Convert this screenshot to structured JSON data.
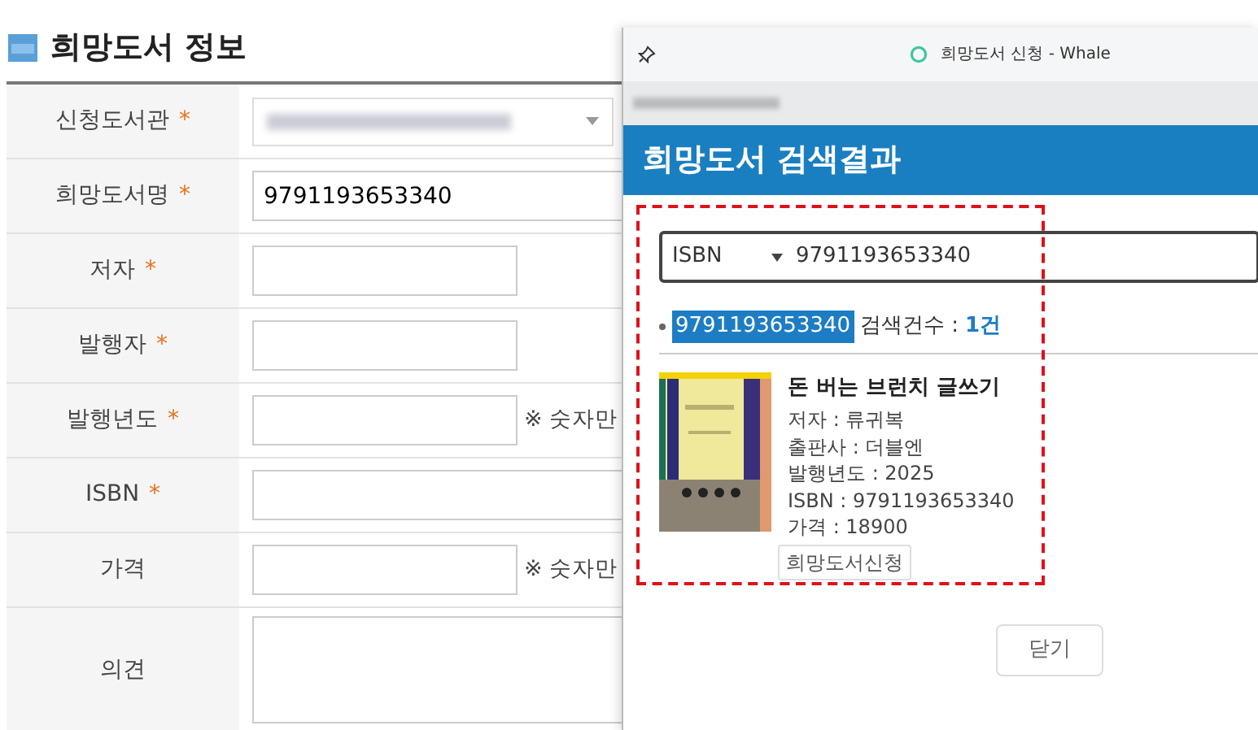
{
  "page": {
    "title": "희망도서 정보"
  },
  "form": {
    "required_mark": "*",
    "rows": [
      {
        "label": "신청도서관",
        "required": true,
        "kind": "select"
      },
      {
        "label": "희망도서명",
        "required": true,
        "kind": "text",
        "value": "9791193653340"
      },
      {
        "label": "저자",
        "required": true,
        "kind": "short"
      },
      {
        "label": "발행자",
        "required": true,
        "kind": "short"
      },
      {
        "label": "발행년도",
        "required": true,
        "kind": "short",
        "note": "※ 숫자만"
      },
      {
        "label": "ISBN",
        "required": true,
        "kind": "text"
      },
      {
        "label": "가격",
        "required": false,
        "kind": "short",
        "note": "※ 숫자만"
      },
      {
        "label": "의견",
        "required": false,
        "kind": "textarea"
      }
    ]
  },
  "popup": {
    "window_title": "희망도서 신청 - Whale",
    "header": "희망도서 검색결과",
    "search": {
      "type": "ISBN",
      "value": "9791193653340"
    },
    "result": {
      "query": "9791193653340",
      "count_label": "검색건수 :",
      "count": "1건"
    },
    "books": [
      {
        "title": "돈 버는 브런치 글쓰기",
        "details": [
          "저자 : 류귀복",
          "출판사 : 더블엔",
          "발행년도 : 2025",
          "ISBN : 9791193653340",
          "가격 : 18900"
        ],
        "button": "희망도서신청"
      }
    ],
    "close_button": "닫기"
  }
}
